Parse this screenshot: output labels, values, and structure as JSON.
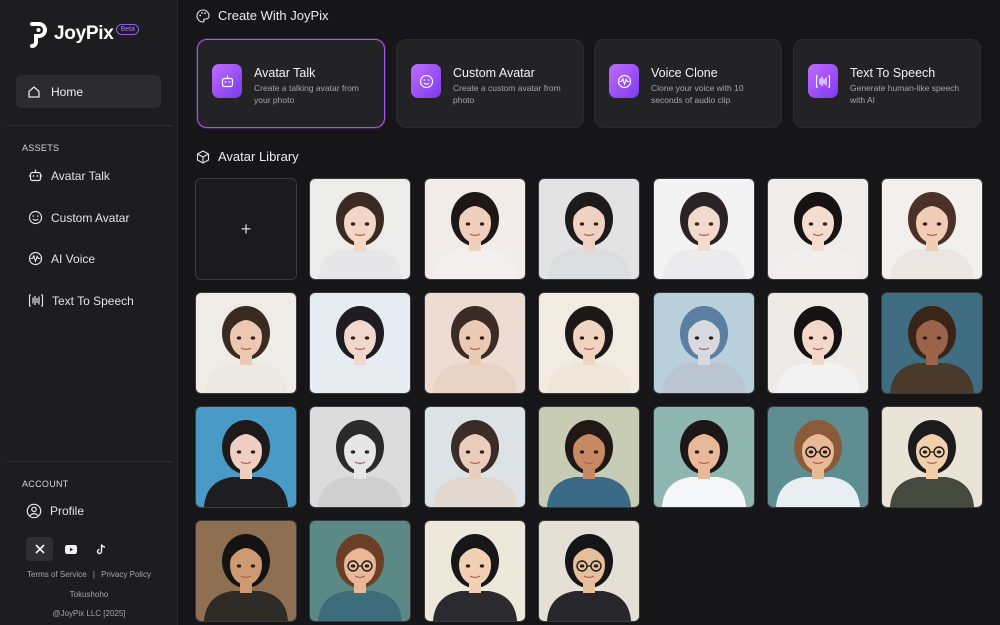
{
  "brand": {
    "name": "JoyPix",
    "badge": "Beta"
  },
  "sidebar": {
    "home_label": "Home",
    "assets_label": "ASSETS",
    "assets": [
      {
        "label": "Avatar Talk",
        "icon": "robot-icon"
      },
      {
        "label": "Custom Avatar",
        "icon": "smiley-icon"
      },
      {
        "label": "AI Voice",
        "icon": "waveform-icon"
      },
      {
        "label": "Text To Speech",
        "icon": "audio-bars-icon"
      }
    ],
    "account_label": "ACCOUNT",
    "profile_label": "Profile",
    "socials": [
      "x-icon",
      "youtube-icon",
      "tiktok-icon"
    ],
    "terms": "Terms of Service",
    "divider": "|",
    "privacy": "Privacy Policy",
    "tokushoho": "Tokushoho",
    "copyright": "@JoyPix LLC [2025]"
  },
  "create": {
    "title": "Create With JoyPix",
    "cards": [
      {
        "title": "Avatar Talk",
        "desc": "Create a talking avatar from your photo",
        "icon": "robot-icon",
        "active": true
      },
      {
        "title": "Custom Avatar",
        "desc": "Create a custom avatar from photo",
        "icon": "smiley-icon",
        "active": false
      },
      {
        "title": "Voice Clone",
        "desc": "Clone your voice with 10 seconds of audio clip",
        "icon": "waveform-icon",
        "active": false
      },
      {
        "title": "Text To Speech",
        "desc": "Generate human-like speech with AI",
        "icon": "audio-bars-icon",
        "active": false
      }
    ]
  },
  "library": {
    "title": "Avatar Library",
    "add_symbol": "+",
    "avatars": [
      {
        "bg": "#ececea",
        "hair": "#3a2a22",
        "skin": "#f3d6c4",
        "shirt": "#e6e6e8",
        "glasses": false
      },
      {
        "bg": "#f1ece8",
        "hair": "#1f1715",
        "skin": "#f0cfbd",
        "shirt": "#f2f0ee",
        "glasses": false
      },
      {
        "bg": "#e3e3e4",
        "hair": "#1c1a1b",
        "skin": "#efd2c1",
        "shirt": "#dcdde0",
        "glasses": false
      },
      {
        "bg": "#f3f3f4",
        "hair": "#2a2226",
        "skin": "#f2d9cc",
        "shirt": "#ebebee",
        "glasses": false
      },
      {
        "bg": "#efece9",
        "hair": "#171314",
        "skin": "#f4dccf",
        "shirt": "#f0efee",
        "glasses": false
      },
      {
        "bg": "#f2efec",
        "hair": "#4a3026",
        "skin": "#f1cdb8",
        "shirt": "#ece6e2",
        "glasses": false
      },
      {
        "bg": "#efebe6",
        "hair": "#3b2a20",
        "skin": "#ecc9b0",
        "shirt": "#ece8e2",
        "glasses": false
      },
      {
        "bg": "#e6edf2",
        "hair": "#1e1c22",
        "skin": "#f1d8cc",
        "shirt": "#e8ebee",
        "glasses": false
      },
      {
        "bg": "#ecdcd2",
        "hair": "#3a2b24",
        "skin": "#eacab4",
        "shirt": "#e9d3c6",
        "glasses": false
      },
      {
        "bg": "#f1ebe2",
        "hair": "#1d1818",
        "skin": "#f1d4c0",
        "shirt": "#efe6da",
        "glasses": false
      },
      {
        "bg": "#b9cfdc",
        "hair": "#5c7ea3",
        "skin": "#d9d9e0",
        "shirt": "#b9c6d2",
        "glasses": false
      },
      {
        "bg": "#eeeae6",
        "hair": "#141213",
        "skin": "#f3d8c9",
        "shirt": "#f2f2f2",
        "glasses": false
      },
      {
        "bg": "#3e6c80",
        "hair": "#3a2418",
        "skin": "#9b6448",
        "shirt": "#4a3a2e",
        "glasses": false
      },
      {
        "bg": "#4a9ac8",
        "hair": "#1e1a1c",
        "skin": "#f0cfc3",
        "shirt": "#1e1e22",
        "glasses": false
      },
      {
        "bg": "#dcdcdc",
        "hair": "#2a2a2a",
        "skin": "#e6e6e6",
        "shirt": "#cfcfcf",
        "glasses": false
      },
      {
        "bg": "#dde2e6",
        "hair": "#3a2c26",
        "skin": "#ebcdbb",
        "shirt": "#e2d8d0",
        "glasses": false
      },
      {
        "bg": "#c9ccb4",
        "hair": "#201815",
        "skin": "#c58a64",
        "shirt": "#3a6a86",
        "glasses": false
      },
      {
        "bg": "#8fb6b0",
        "hair": "#1c1616",
        "skin": "#e8b998",
        "shirt": "#f4f6f7",
        "glasses": false
      },
      {
        "bg": "#5e8e92",
        "hair": "#8a5a3a",
        "skin": "#e9b894",
        "shirt": "#e8eef2",
        "glasses": true
      },
      {
        "bg": "#e9e4d6",
        "hair": "#1b1b1d",
        "skin": "#f0cfaa",
        "shirt": "#45493e",
        "glasses": true
      },
      {
        "bg": "#8f6f52",
        "hair": "#141312",
        "skin": "#cd9a72",
        "shirt": "#2e2a26",
        "glasses": false
      },
      {
        "bg": "#5b8a86",
        "hair": "#6a3f26",
        "skin": "#e9b896",
        "shirt": "#3d6d7a",
        "glasses": true
      },
      {
        "bg": "#ede8da",
        "hair": "#17171a",
        "skin": "#f1d0b4",
        "shirt": "#2b2b2f",
        "glasses": false
      },
      {
        "bg": "#e4e0d6",
        "hair": "#151517",
        "skin": "#e6bf9c",
        "shirt": "#27272b",
        "glasses": true
      }
    ]
  }
}
